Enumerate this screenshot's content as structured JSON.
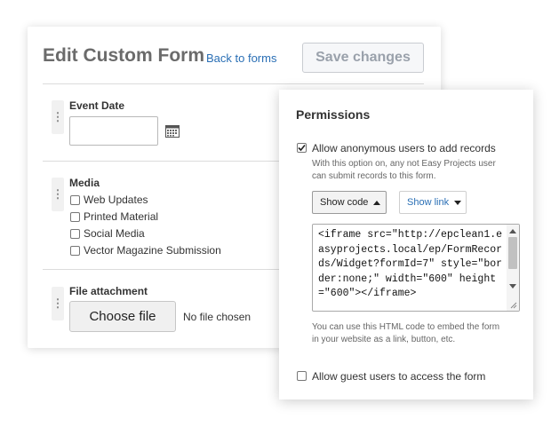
{
  "form": {
    "title": "Edit Custom Form",
    "back_link": "Back to forms",
    "save_label": "Save changes"
  },
  "fields": {
    "event_date": {
      "label": "Event Date",
      "value": "",
      "icon": "calendar-icon"
    },
    "media": {
      "label": "Media",
      "options": [
        {
          "label": "Web Updates",
          "checked": false
        },
        {
          "label": "Printed Material",
          "checked": false
        },
        {
          "label": "Social Media",
          "checked": false
        },
        {
          "label": "Vector Magazine Submission",
          "checked": false
        }
      ]
    },
    "file_attachment": {
      "label": "File attachment",
      "button_label": "Choose file",
      "status": "No file chosen"
    },
    "drag_handle_glyph": "⋮"
  },
  "permissions": {
    "title": "Permissions",
    "anonymous": {
      "label": "Allow anonymous users to add records",
      "checked": true,
      "hint_line1": "With this option on, any not Easy Projects user",
      "hint_line2": "can submit records to this form."
    },
    "show_code_label": "Show code",
    "show_link_label": "Show link",
    "embed_code": "<iframe src=\"http://epclean1.easyprojects.local/ep/FormRecords/Widget?formId=7\" style=\"border:none;\" width=\"600\" height=\"600\"></iframe>",
    "embed_hint_line1": "You can use this HTML code to embed the form",
    "embed_hint_line2": "in your website as a link, button, etc.",
    "guest": {
      "label": "Allow guest users to access the form",
      "checked": false
    }
  },
  "colors": {
    "link": "#2a6fb5",
    "title_gray": "#6b6b6b",
    "save_disabled_text": "#9aa1ab"
  }
}
